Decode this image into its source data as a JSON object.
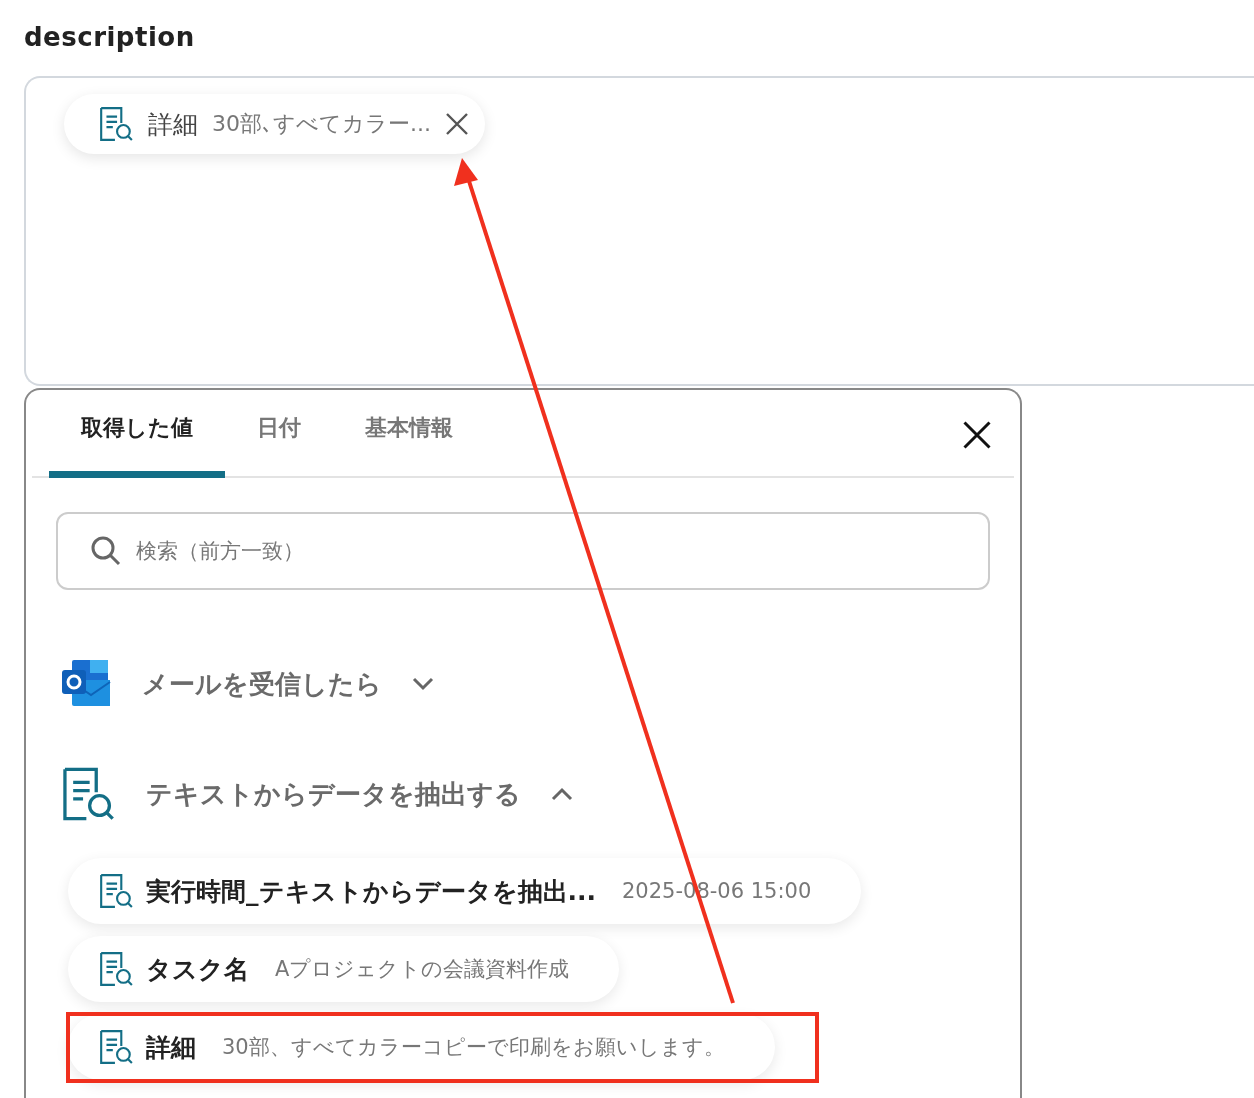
{
  "field": {
    "label": "description",
    "chips": [
      {
        "name": "詳細",
        "value": "30部､すべてカラー..."
      }
    ]
  },
  "panel": {
    "tabs": [
      {
        "label": "取得した値",
        "selected": true
      },
      {
        "label": "日付",
        "selected": false
      },
      {
        "label": "基本情報",
        "selected": false
      }
    ],
    "search": {
      "placeholder": "検索（前方一致）"
    },
    "groups": [
      {
        "kind": "mail",
        "title": "メールを受信したら",
        "expanded": false
      },
      {
        "kind": "extract",
        "title": "テキストからデータを抽出する",
        "expanded": true,
        "items": [
          {
            "name": "実行時間_テキストからデータを抽出...",
            "value": "2025-08-06 15:00",
            "highlighted": false
          },
          {
            "name": "タスク名",
            "value": "Aプロジェクトの会議資料作成",
            "highlighted": false
          },
          {
            "name": "詳細",
            "value": "30部、すべてカラーコピーで印刷をお願いします。",
            "highlighted": true
          }
        ]
      }
    ]
  },
  "annotation": {
    "arrow": true
  }
}
